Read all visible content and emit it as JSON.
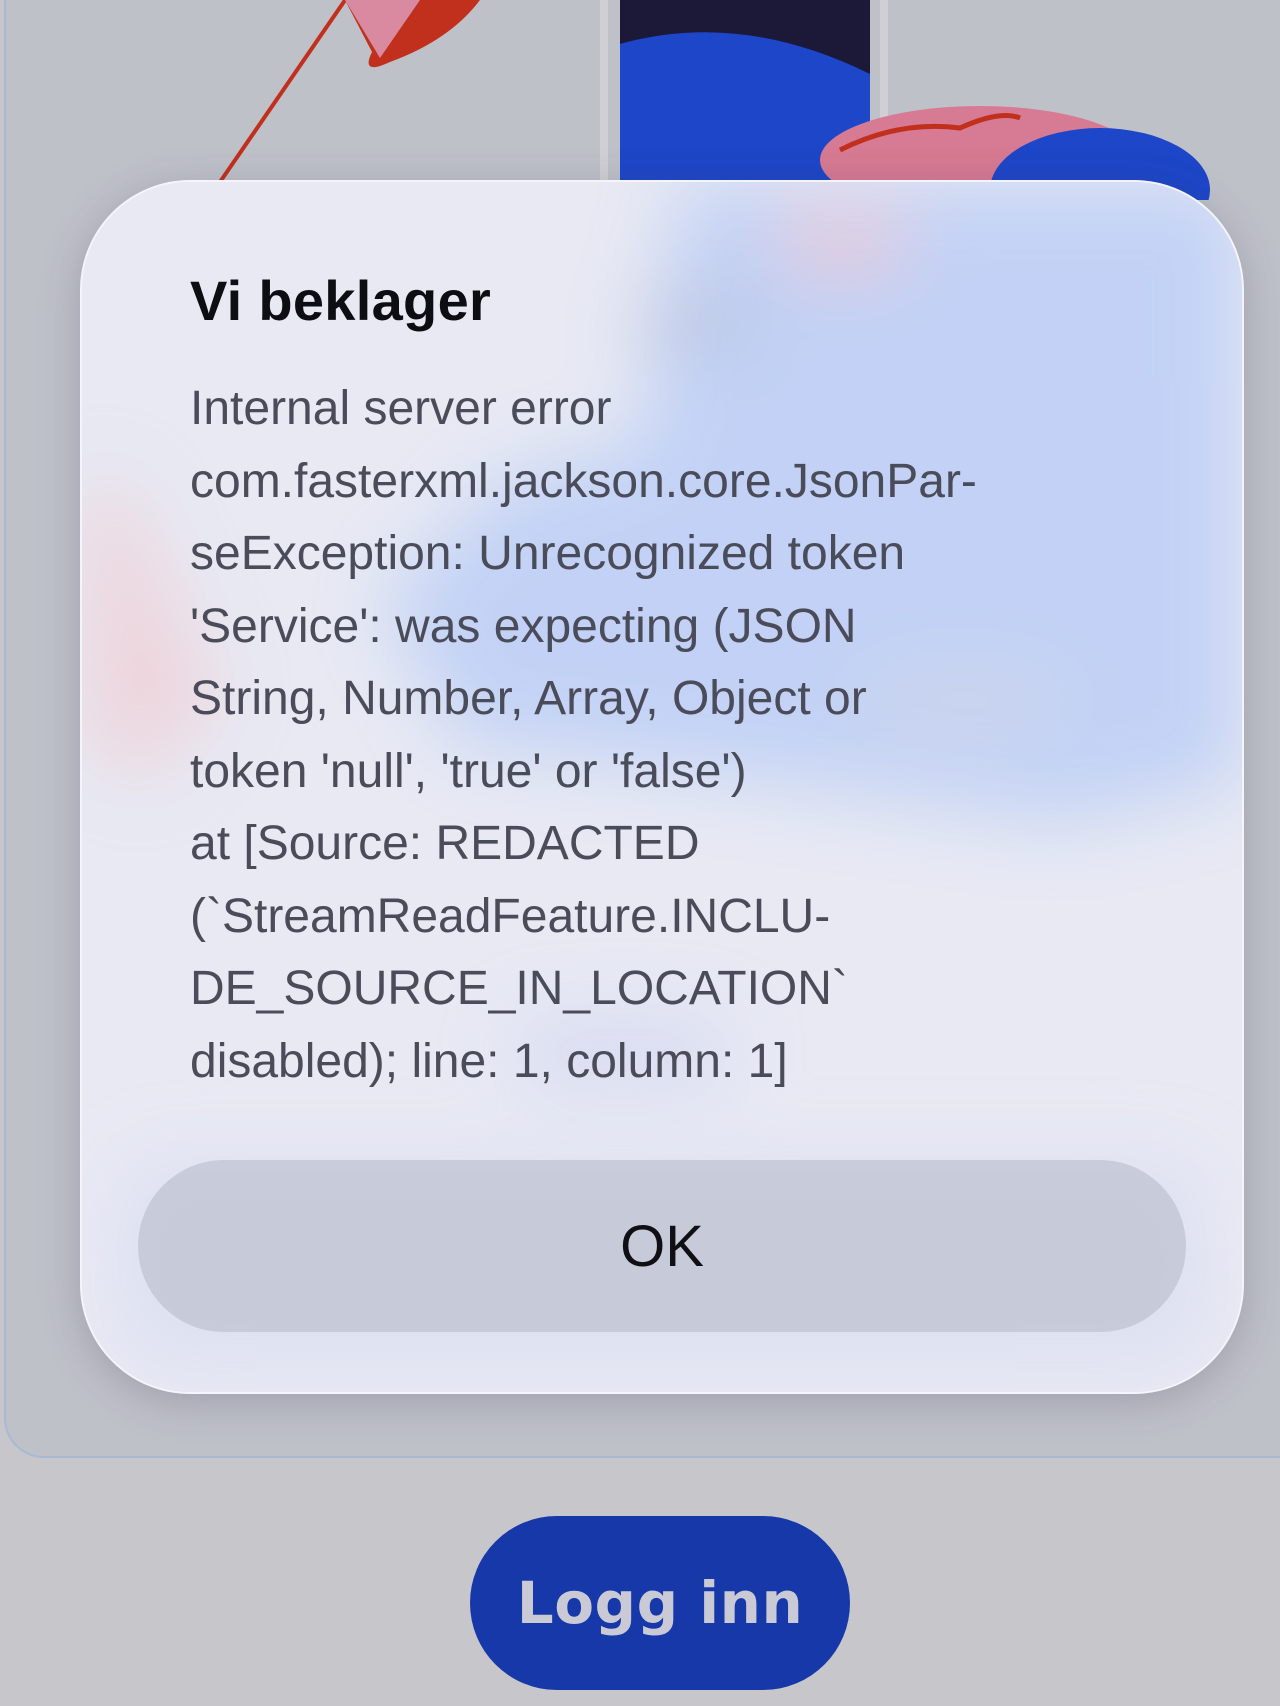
{
  "dialog": {
    "title": "Vi beklager",
    "message": "Internal server error\ncom.fasterxml.jackson.core.JsonPar-\nseException: Unrecognized token\n'Service': was expecting (JSON\nString, Number, Array, Object or\ntoken 'null', 'true' or 'false')\n at [Source: REDACTED\n(`StreamReadFeature.INCLU-\nDE_SOURCE_IN_LOCATION`\ndisabled); line: 1, column: 1]",
    "ok_label": "OK"
  },
  "background": {
    "login_label": "Logg inn"
  },
  "colors": {
    "accent": "#1638a8",
    "dialog_background": "#e8eaf5",
    "page_background": "#c6c6cb"
  }
}
